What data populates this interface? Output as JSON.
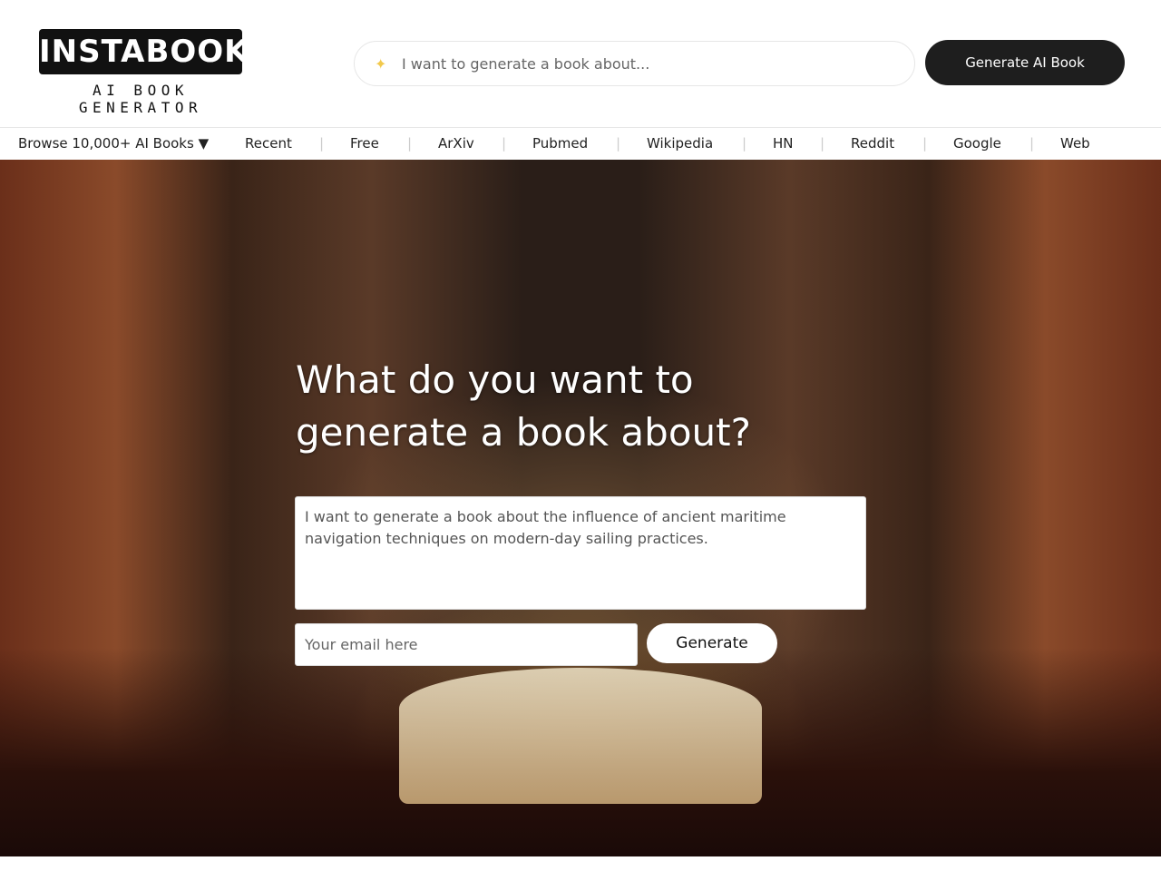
{
  "logo": {
    "title": "INSTABOOKS",
    "subtitle": "AI BOOK GENERATOR"
  },
  "search": {
    "placeholder": "I want to generate a book about...",
    "icon": "sparkles-icon"
  },
  "header_button": "Generate AI Book",
  "nav": {
    "browse": "Browse 10,000+ AI Books ▼",
    "items": [
      "Recent",
      "Free",
      "ArXiv",
      "Pubmed",
      "Wikipedia",
      "HN",
      "Reddit",
      "Google",
      "Web"
    ]
  },
  "hero": {
    "title": "What do you want to generate a book about?",
    "prompt_value": "I want to generate a book about the influence of ancient maritime navigation techniques on modern-day sailing practices.",
    "email_placeholder": "Your email here",
    "generate_label": "Generate"
  }
}
